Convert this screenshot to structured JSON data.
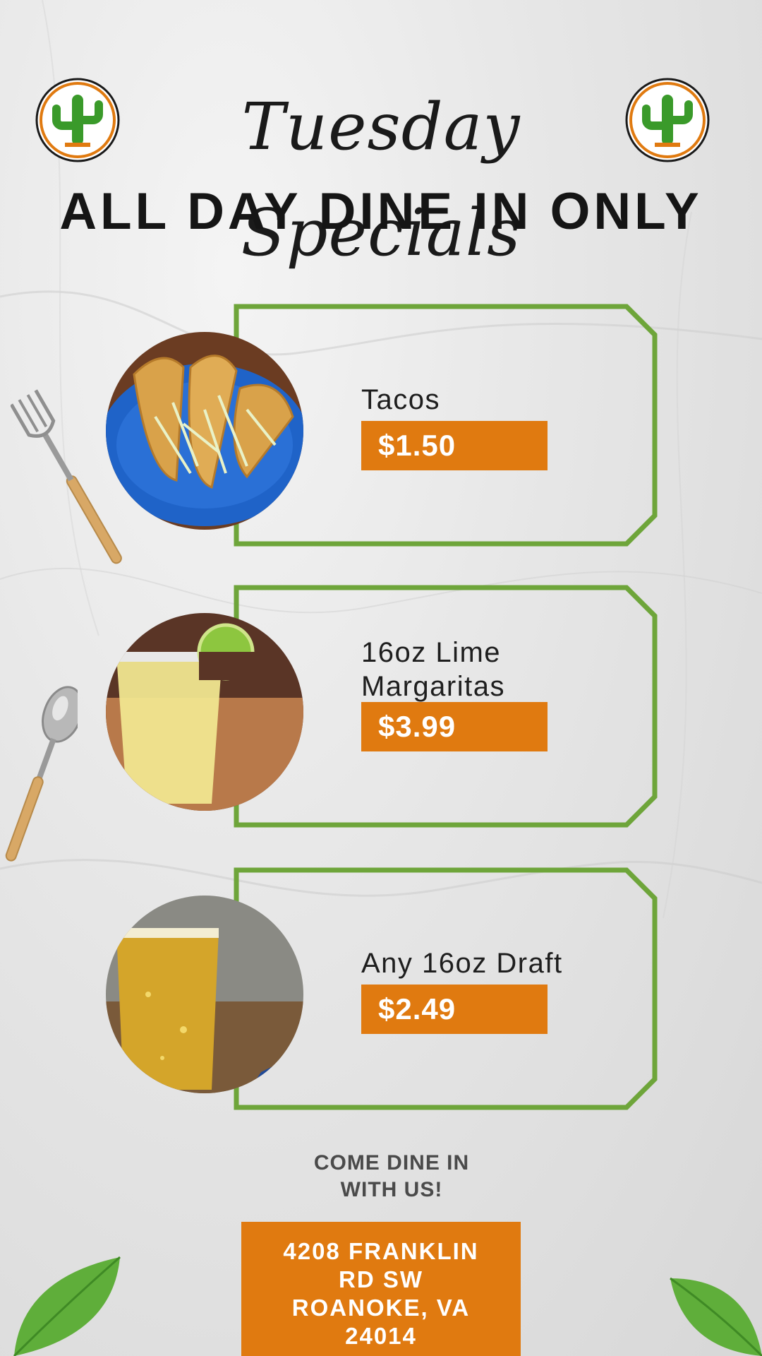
{
  "header": {
    "script_title": "Tuesday Specials",
    "headline": "ALL DAY DINE IN ONLY"
  },
  "specials": [
    {
      "name": "Tacos",
      "price": "$1.50",
      "photo_icon": "tacos-photo"
    },
    {
      "name": "16oz Lime Margaritas",
      "name_line1": "16oz Lime",
      "name_line2": "Margaritas",
      "price": "$3.99",
      "photo_icon": "margarita-photo"
    },
    {
      "name": "Any 16oz Draft",
      "price": "$2.49",
      "photo_icon": "beer-photo"
    }
  ],
  "footer": {
    "cta_line1": "COME DINE IN",
    "cta_line2": "WITH US!",
    "address_lines": [
      "4208 FRANKLIN",
      "RD SW",
      "ROANOKE, VA",
      "24014"
    ]
  },
  "colors": {
    "accent_orange": "#e07a10",
    "frame_green": "#6ea53a",
    "cactus_green": "#3a9a2a"
  }
}
